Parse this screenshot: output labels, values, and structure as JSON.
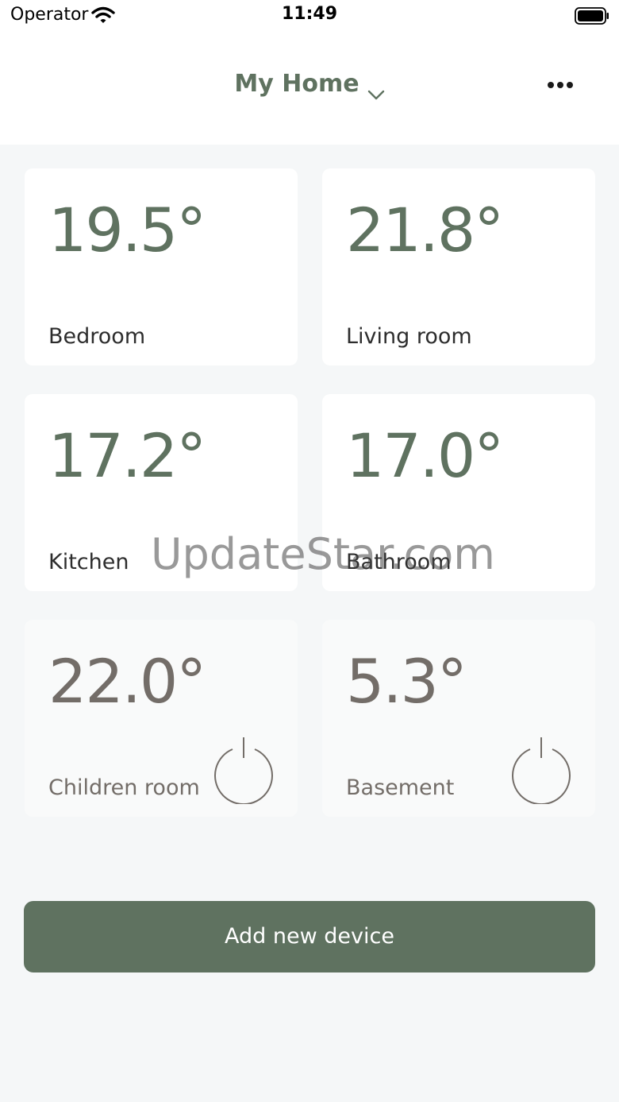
{
  "status_bar": {
    "carrier": "Operator",
    "time": "11:49"
  },
  "header": {
    "title": "My Home",
    "dropdown_icon": "chevron-down-icon",
    "more_icon": "more-horizontal-icon"
  },
  "rooms": [
    {
      "temperature": "19.5°",
      "name": "Bedroom",
      "state": "on"
    },
    {
      "temperature": "21.8°",
      "name": "Living room",
      "state": "on"
    },
    {
      "temperature": "17.2°",
      "name": "Kitchen",
      "state": "on"
    },
    {
      "temperature": "17.0°",
      "name": "Bathroom",
      "state": "on"
    },
    {
      "temperature": "22.0°",
      "name": "Children room",
      "state": "off"
    },
    {
      "temperature": "5.3°",
      "name": "Basement",
      "state": "off"
    }
  ],
  "add_button": {
    "label": "Add new device"
  },
  "watermark": "UpdateStar.com",
  "colors": {
    "accent": "#5f7260",
    "off_text": "#736d68",
    "background": "#f5f7f8"
  }
}
